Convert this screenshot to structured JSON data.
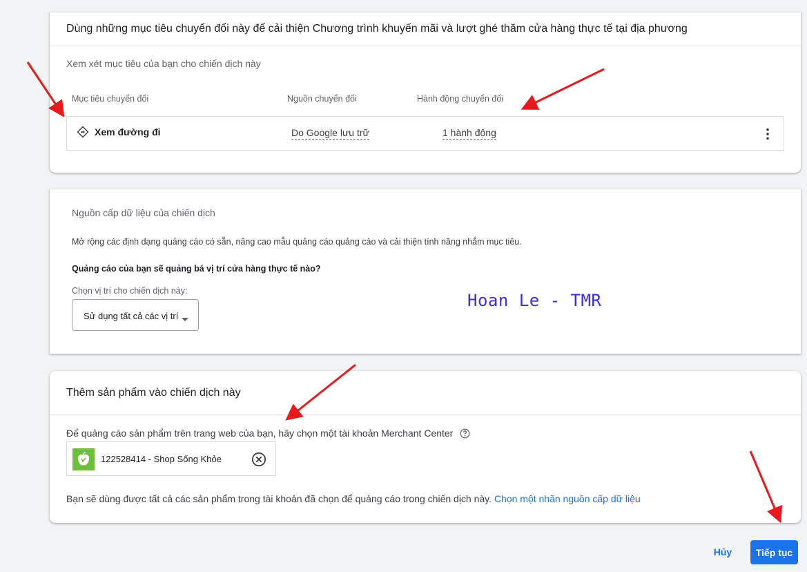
{
  "conversion_goals": {
    "title": "Dùng những mục tiêu chuyển đổi này để cải thiện Chương trình khuyến mãi và lượt ghé thăm cửa hàng thực tế tại địa phương",
    "subtitle": "Xem xét mục tiêu của bạn cho chiến dịch này",
    "columns": [
      "Mục tiêu chuyển đổi",
      "Nguồn chuyển đổi",
      "Hành động chuyển đổi"
    ],
    "row": {
      "goal": "Xem đường đi",
      "goal_icon": "directions-icon",
      "source": "Do Google lưu trữ",
      "action": "1 hành động",
      "more_icon": "more-vert-icon"
    }
  },
  "data_feed": {
    "title": "Nguồn cấp dữ liệu của chiến dịch",
    "description": "Mở rộng các định dạng quảng cáo có sẵn, nâng cao mẫu quảng cáo quảng cáo và cải thiện tính năng nhắm mục tiêu.",
    "question": "Quảng cáo của bạn sẽ quảng bá vị trí cửa hàng thực tế nào?",
    "select_label": "Chọn vị trí cho chiến dịch này:",
    "select_value": "Sử dụng tất cả các vị trí"
  },
  "watermark": "Hoan Le - TMR",
  "products": {
    "title": "Thêm sản phẩm vào chiến dịch này",
    "instruction": "Để quảng cáo sản phẩm trên trang web của bạn, hãy chọn một tài khoản Merchant Center",
    "help_icon": "help-icon",
    "merchant_account": "122528414 - Shop Sống Khỏe",
    "merchant_logo": "apple-logo-icon",
    "remove_icon": "remove-circle-icon",
    "footer_text": "Bạn sẽ dùng được tất cả các sản phẩm trong tài khoản đã chọn để quảng cáo trong chiến dịch này.",
    "footer_link": "Chọn một nhãn nguồn cấp dữ liệu"
  },
  "actions": {
    "cancel": "Hủy",
    "next": "Tiếp tục"
  },
  "colors": {
    "accent": "#1a73e8",
    "annotation_arrow": "#e8191c",
    "watermark": "#3b2ee6",
    "merchant_logo_bg": "#6bbf3a"
  }
}
